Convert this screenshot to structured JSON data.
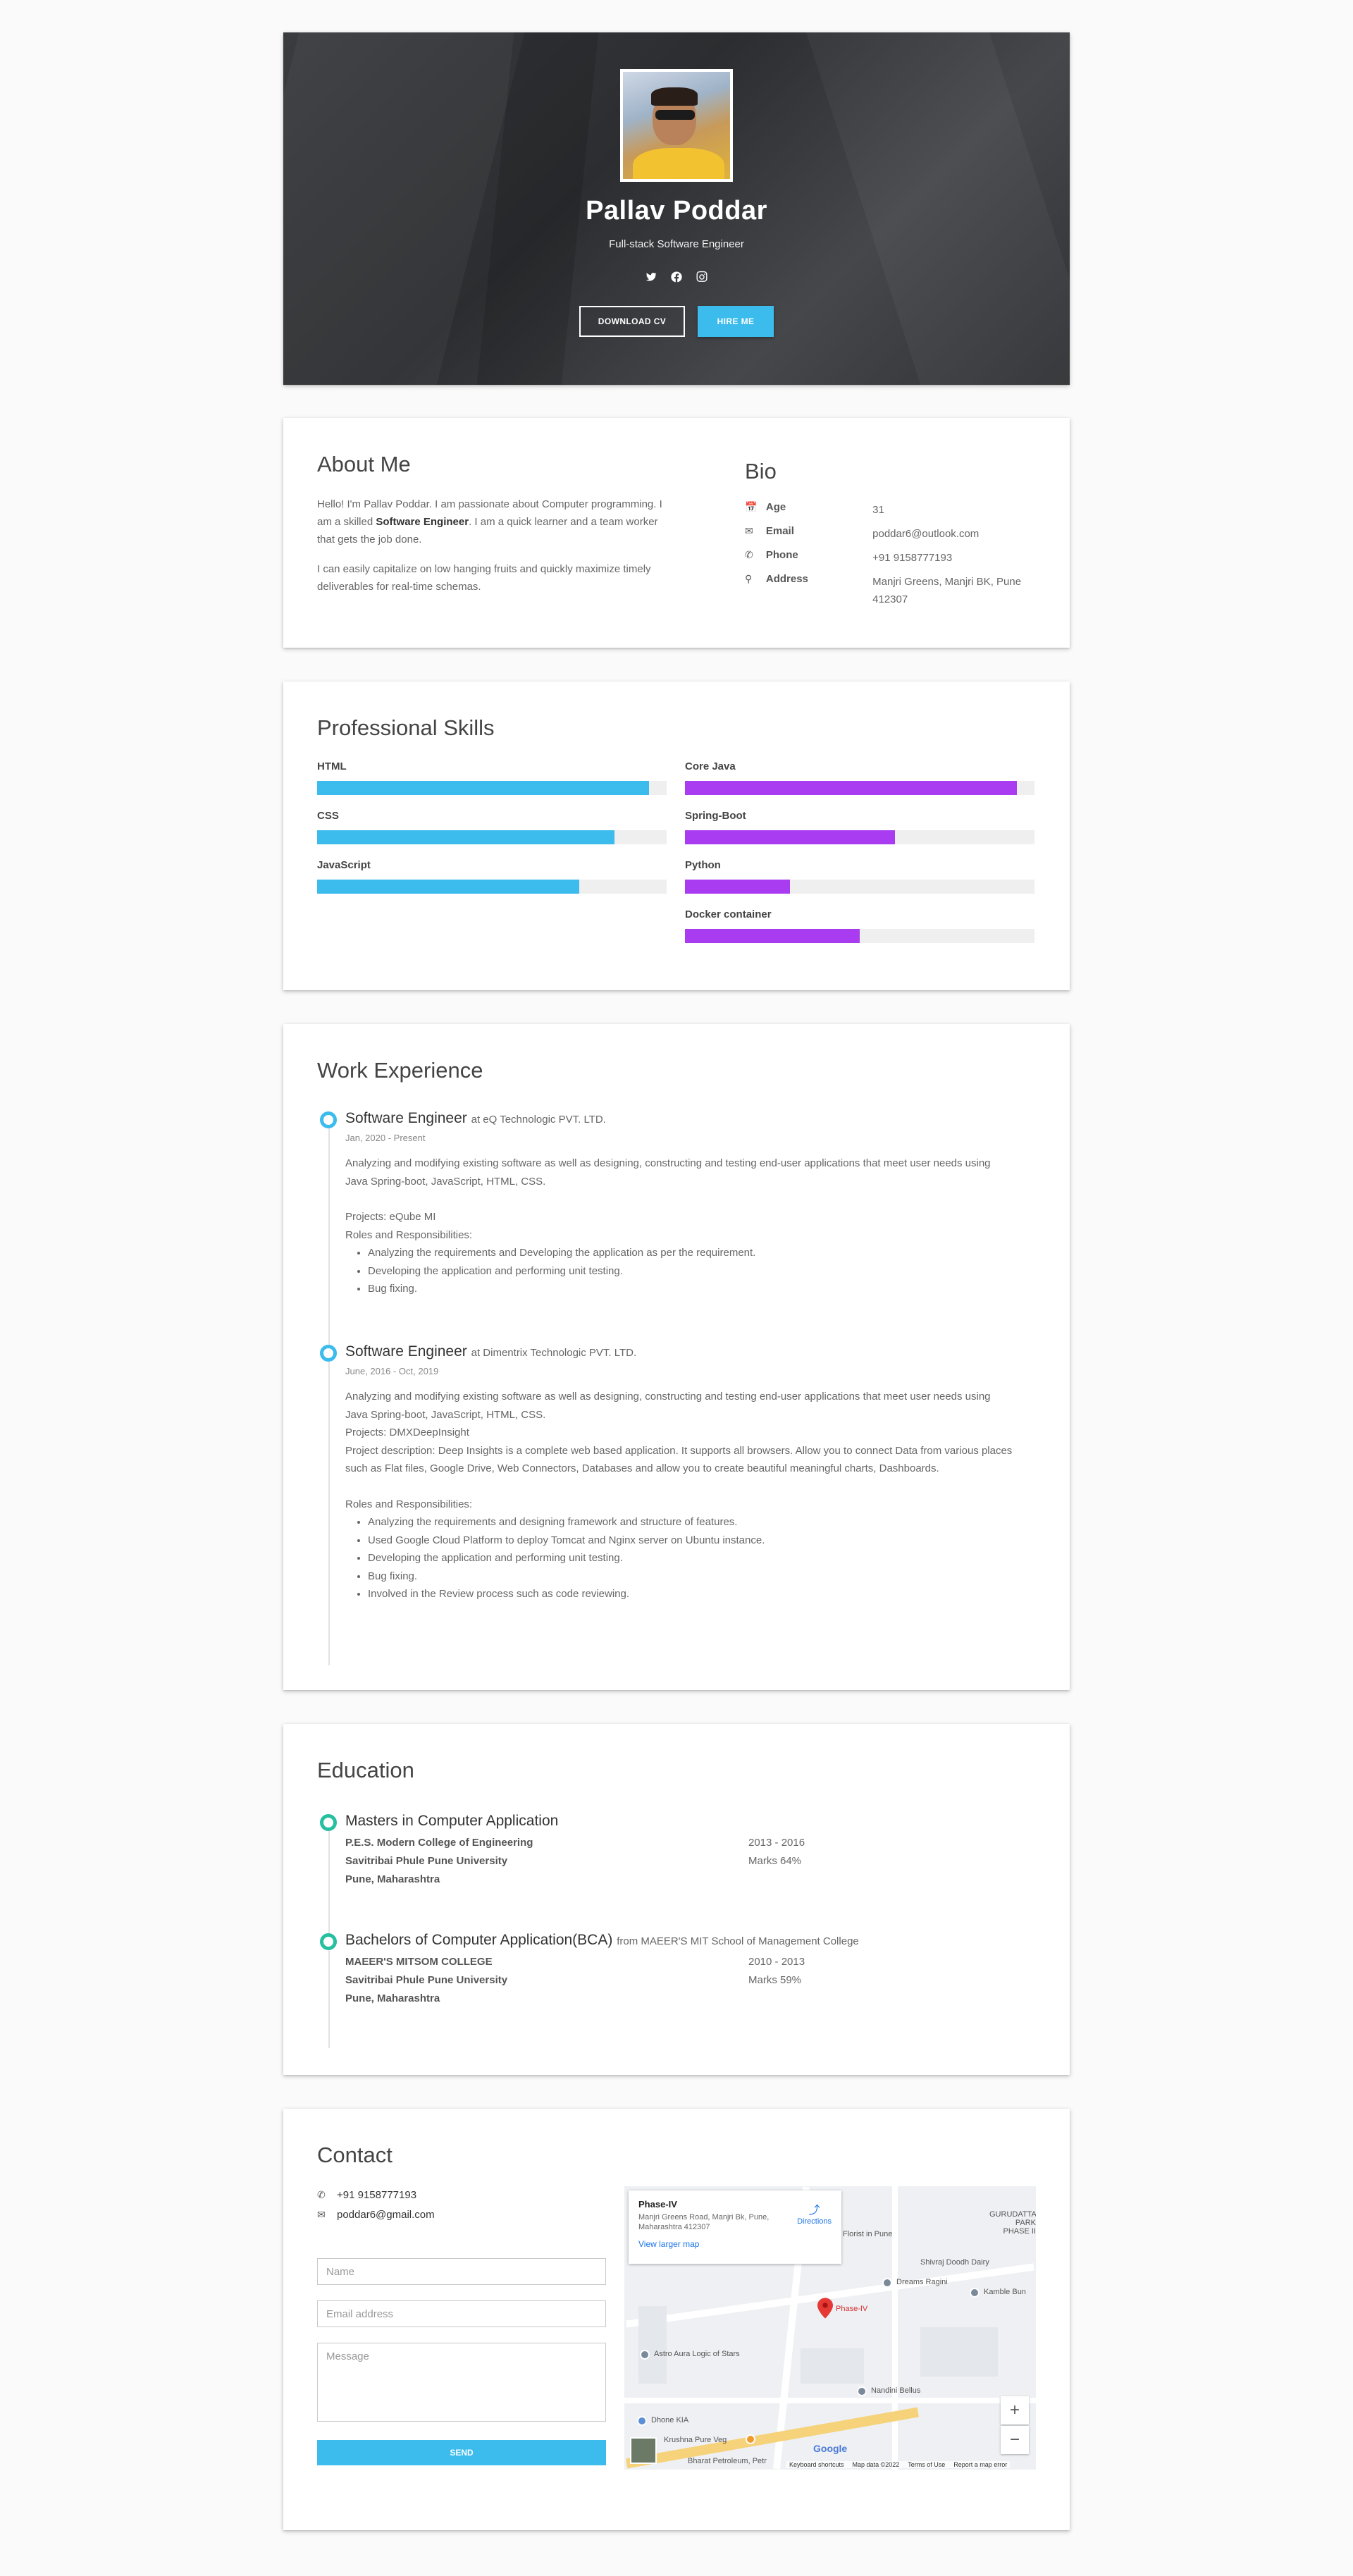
{
  "hero": {
    "name": "Pallav Poddar",
    "title": "Full-stack Software Engineer",
    "socials": [
      "twitter-icon",
      "facebook-icon",
      "instagram-icon"
    ],
    "download_label": "DOWNLOAD CV",
    "hire_label": "HIRE ME"
  },
  "about": {
    "title": "About Me",
    "p1_before": "Hello! I'm Pallav Poddar. I am passionate about Computer programming. I am a skilled ",
    "p1_bold": "Software Engineer",
    "p1_after": ". I am a quick learner and a team worker that gets the job done.",
    "p2": "I can easily capitalize on low hanging fruits and quickly maximize timely deliverables for real-time schemas."
  },
  "bio": {
    "title": "Bio",
    "rows": [
      {
        "icon": "calendar-icon",
        "key": "Age",
        "value": "31"
      },
      {
        "icon": "envelope-icon",
        "key": "Email",
        "value": "poddar6@outlook.com"
      },
      {
        "icon": "phone-icon",
        "key": "Phone",
        "value": "+91 9158777193"
      },
      {
        "icon": "location-pin-icon",
        "key": "Address",
        "value": "Manjri Greens, Manjri BK, Pune 412307"
      }
    ]
  },
  "skills": {
    "title": "Professional Skills",
    "left_color": "#3cbcec",
    "right_color": "#a93cf0",
    "left": [
      {
        "name": "HTML",
        "level": 0.95
      },
      {
        "name": "CSS",
        "level": 0.85
      },
      {
        "name": "JavaScript",
        "level": 0.75
      }
    ],
    "right": [
      {
        "name": "Core Java",
        "level": 0.95
      },
      {
        "name": "Spring-Boot",
        "level": 0.6
      },
      {
        "name": "Python",
        "level": 0.3
      },
      {
        "name": "Docker container",
        "level": 0.5
      }
    ]
  },
  "experience": {
    "title": "Work Experience",
    "jobs": [
      {
        "role": "Software Engineer",
        "company": "at eQ Technologic PVT. LTD.",
        "date": "Jan, 2020 - Present",
        "desc": "Analyzing and modifying existing software as well as designing, constructing and testing end-user applications that meet user needs using Java Spring-boot, JavaScript, HTML, CSS.",
        "projects": "Projects: eQube MI",
        "roles_label": "Roles and Responsibilities:",
        "bullets": [
          "Analyzing the requirements and Developing the application as per the requirement.",
          "Developing the application and performing unit testing.",
          "Bug fixing."
        ]
      },
      {
        "role": "Software Engineer",
        "company": "at Dimentrix Technologic PVT. LTD.",
        "date": "June, 2016 - Oct, 2019",
        "desc": "Analyzing and modifying existing software as well as designing, constructing and testing end-user applications that meet user needs using Java Spring-boot, JavaScript, HTML, CSS.",
        "projects": "Projects: DMXDeepInsight",
        "project_desc": "Project description: Deep Insights is a complete web based application. It supports all browsers. Allow you to connect Data from various places such as Flat files, Google Drive, Web Connectors, Databases and allow you to create beautiful meaningful charts, Dashboards.",
        "roles_label": "Roles and Responsibilities:",
        "bullets": [
          "Analyzing the requirements and designing framework and structure of features.",
          "Used Google Cloud Platform to deploy Tomcat and Nginx server on Ubuntu instance.",
          "Developing the application and performing unit testing.",
          "Bug fixing.",
          "Involved in the Review process such as code reviewing."
        ]
      }
    ]
  },
  "education": {
    "title": "Education",
    "degrees": [
      {
        "name": "Masters in Computer Application",
        "extra": "",
        "college": "P.E.S. Modern College of Engineering",
        "years": "2013 - 2016",
        "university": "Savitribai Phule Pune University",
        "marks": "Marks 64%",
        "city": "Pune, Maharashtra"
      },
      {
        "name": "Bachelors of Computer Application(BCA)",
        "extra": "from MAEER'S MIT School of Management College",
        "college": "MAEER'S MITSOM COLLEGE",
        "years": "2010 - 2013",
        "university": "Savitribai Phule Pune University",
        "marks": "Marks 59%",
        "city": "Pune, Maharashtra"
      }
    ]
  },
  "contact": {
    "title": "Contact",
    "phone": "+91 9158777193",
    "email": "poddar6@gmail.com",
    "name_placeholder": "Name",
    "email_placeholder": "Email address",
    "message_placeholder": "Message",
    "send_label": "SEND"
  },
  "map": {
    "place": "Phase-IV",
    "address": "Manjri Greens Road, Manjri Bk, Pune, Maharashtra 412307",
    "view_larger": "View larger map",
    "directions": "Directions",
    "marker_label": "Phase-IV",
    "labels": {
      "gurudatta": "GURUDATTA PARK PHASE II",
      "florist": "Florist in Pune",
      "shivraj": "Shivraj Doodh Dairy",
      "dreams": "Dreams Ragini",
      "kamble": "Kamble Bun",
      "astro": "Astro Aura Logic of Stars",
      "nandini": "Nandini Bellus",
      "dhone": "Dhone KIA",
      "krushna": "Krushna Pure Veg",
      "bharat": "Bharat Petroleum, Petr"
    },
    "footer": [
      "Keyboard shortcuts",
      "Map data ©2022",
      "Terms of Use",
      "Report a map error"
    ],
    "google": "Google"
  }
}
